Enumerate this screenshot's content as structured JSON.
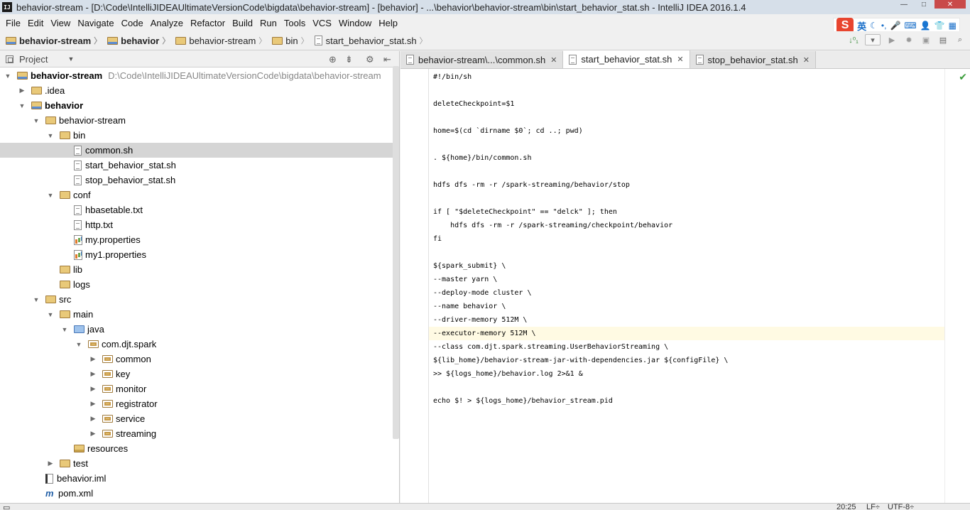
{
  "window": {
    "title": "behavior-stream - [D:\\Code\\IntelliJIDEAUltimateVersionCode\\bigdata\\behavior-stream] - [behavior] - ...\\behavior\\behavior-stream\\bin\\start_behavior_stat.sh - IntelliJ IDEA 2016.1.4"
  },
  "menu": [
    "File",
    "Edit",
    "View",
    "Navigate",
    "Code",
    "Analyze",
    "Refactor",
    "Build",
    "Run",
    "Tools",
    "VCS",
    "Window",
    "Help"
  ],
  "ime": {
    "logo": "S",
    "mode": "英"
  },
  "breadcrumb": [
    "behavior-stream",
    "behavior",
    "behavior-stream",
    "bin",
    "start_behavior_stat.sh"
  ],
  "project_panel": {
    "title": "Project"
  },
  "tree": [
    {
      "label": "behavior-stream",
      "path": "D:\\Code\\IntelliJIDEAUltimateVersionCode\\bigdata\\behavior-stream",
      "icon": "module-folder-icon",
      "expanded": true,
      "bold": true
    },
    {
      "label": ".idea",
      "icon": "folder-icon",
      "expanded": false
    },
    {
      "label": "behavior",
      "icon": "module-folder-icon",
      "expanded": true,
      "bold": true
    },
    {
      "label": "behavior-stream",
      "icon": "folder-icon",
      "expanded": true
    },
    {
      "label": "bin",
      "icon": "folder-icon",
      "expanded": true
    },
    {
      "label": "common.sh",
      "icon": "file-icon",
      "selected": true
    },
    {
      "label": "start_behavior_stat.sh",
      "icon": "file-icon"
    },
    {
      "label": "stop_behavior_stat.sh",
      "icon": "file-icon"
    },
    {
      "label": "conf",
      "icon": "folder-icon",
      "expanded": true
    },
    {
      "label": "hbasetable.txt",
      "icon": "file-icon"
    },
    {
      "label": "http.txt",
      "icon": "file-icon"
    },
    {
      "label": "my.properties",
      "icon": "properties-icon"
    },
    {
      "label": "my1.properties",
      "icon": "properties-icon"
    },
    {
      "label": "lib",
      "icon": "folder-icon"
    },
    {
      "label": "logs",
      "icon": "folder-icon"
    },
    {
      "label": "src",
      "icon": "folder-icon",
      "expanded": true
    },
    {
      "label": "main",
      "icon": "folder-icon",
      "expanded": true
    },
    {
      "label": "java",
      "icon": "source-folder-icon",
      "expanded": true
    },
    {
      "label": "com.djt.spark",
      "icon": "package-icon",
      "expanded": true
    },
    {
      "label": "common",
      "icon": "package-icon",
      "expanded": false
    },
    {
      "label": "key",
      "icon": "package-icon",
      "expanded": false
    },
    {
      "label": "monitor",
      "icon": "package-icon",
      "expanded": false
    },
    {
      "label": "registrator",
      "icon": "package-icon",
      "expanded": false
    },
    {
      "label": "service",
      "icon": "package-icon",
      "expanded": false
    },
    {
      "label": "streaming",
      "icon": "package-icon",
      "expanded": false
    },
    {
      "label": "resources",
      "icon": "resources-folder-icon"
    },
    {
      "label": "test",
      "icon": "folder-icon",
      "expanded": false
    },
    {
      "label": "behavior.iml",
      "icon": "iml-file-icon"
    },
    {
      "label": "pom.xml",
      "icon": "maven-icon"
    }
  ],
  "tabs": [
    {
      "label": "behavior-stream\\...\\common.sh",
      "active": false
    },
    {
      "label": "start_behavior_stat.sh",
      "active": true
    },
    {
      "label": "stop_behavior_stat.sh",
      "active": false
    }
  ],
  "code": [
    "#!/bin/sh",
    "",
    "deleteCheckpoint=$1",
    "",
    "home=$(cd `dirname $0`; cd ..; pwd)",
    "",
    ". ${home}/bin/common.sh",
    "",
    "hdfs dfs -rm -r /spark-streaming/behavior/stop",
    "",
    "if [ \"$deleteCheckpoint\" == \"delck\" ]; then",
    "    hdfs dfs -rm -r /spark-streaming/checkpoint/behavior",
    "fi",
    "",
    "${spark_submit} \\",
    "--master yarn \\",
    "--deploy-mode cluster \\",
    "--name behavior \\",
    "--driver-memory 512M \\",
    "--executor-memory 512M \\",
    "--class com.djt.spark.streaming.UserBehaviorStreaming \\",
    "${lib_home}/behavior-stream-jar-with-dependencies.jar ${configFile} \\",
    ">> ${logs_home}/behavior.log 2>&1 &",
    "",
    "echo $! > ${logs_home}/behavior_stream.pid"
  ],
  "caret_line_index": 19,
  "status": {
    "position": "20:25",
    "line_sep": "LF÷",
    "encoding": "UTF-8÷"
  }
}
